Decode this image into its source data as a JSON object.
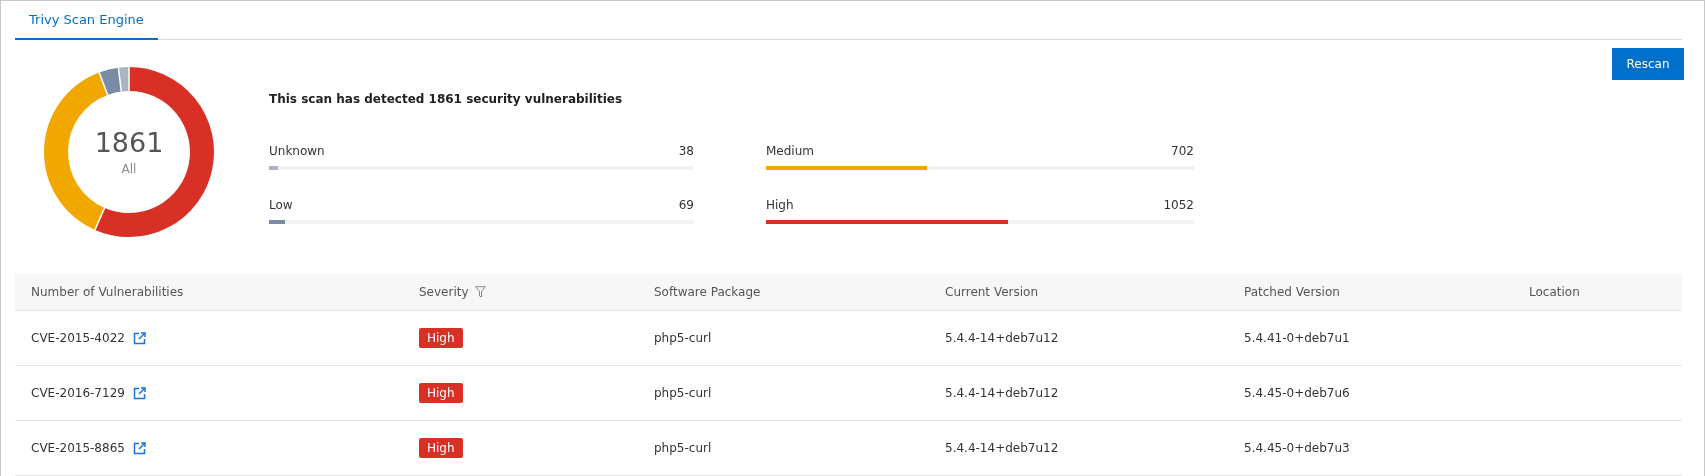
{
  "tabs": [
    {
      "label": "Trivy Scan Engine",
      "selected": true
    }
  ],
  "rescan_button": "Rescan",
  "summary": {
    "center_value": "1861",
    "center_label": "All",
    "heading": "This scan has detected 1861 security vulnerabilities",
    "levels": [
      {
        "label": "Unknown",
        "count": "38",
        "level": 0.02,
        "color": "#a8b4c4"
      },
      {
        "label": "Medium",
        "count": "702",
        "level": 0.377,
        "color": "#f0a800"
      },
      {
        "label": "Low",
        "count": "69",
        "level": 0.037,
        "color": "#7a8ca5"
      },
      {
        "label": "High",
        "count": "1052",
        "level": 0.565,
        "color": "#d93026"
      }
    ]
  },
  "table": {
    "columns": [
      "Number of Vulnerabilities",
      "Severity",
      "Software Package",
      "Current Version",
      "Patched Version",
      "Location"
    ],
    "rows": [
      {
        "cve": "CVE-2015-4022",
        "severity": "High",
        "package": "php5-curl",
        "current": "5.4.4-14+deb7u12",
        "patched": "5.4.41-0+deb7u1"
      },
      {
        "cve": "CVE-2016-7129",
        "severity": "High",
        "package": "php5-curl",
        "current": "5.4.4-14+deb7u12",
        "patched": "5.4.45-0+deb7u6"
      },
      {
        "cve": "CVE-2015-8865",
        "severity": "High",
        "package": "php5-curl",
        "current": "5.4.4-14+deb7u12",
        "patched": "5.4.45-0+deb7u3"
      }
    ]
  }
}
